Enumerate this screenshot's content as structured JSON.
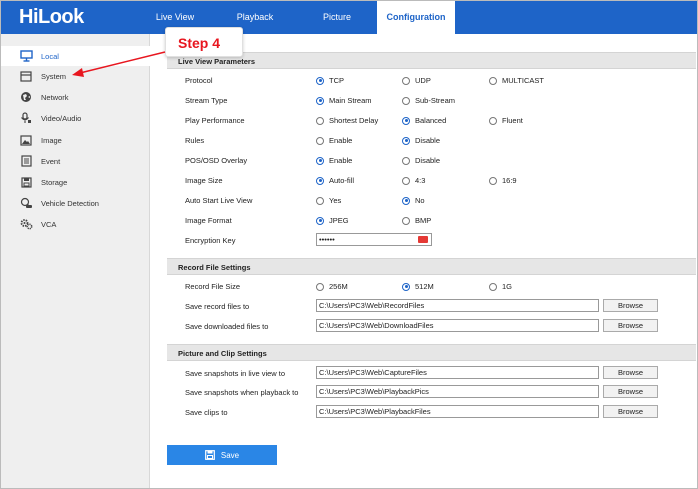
{
  "header": {
    "logo": "HiLook",
    "tabs": [
      "Live View",
      "Playback",
      "Picture",
      "Configuration"
    ],
    "active_tab": "Configuration",
    "accent_color": "#1e64c8"
  },
  "sidebar": {
    "items": [
      {
        "label": "Local",
        "icon": "monitor-icon"
      },
      {
        "label": "System",
        "icon": "window-icon"
      },
      {
        "label": "Network",
        "icon": "globe-icon"
      },
      {
        "label": "Video/Audio",
        "icon": "microphone-icon"
      },
      {
        "label": "Image",
        "icon": "picture-icon"
      },
      {
        "label": "Event",
        "icon": "event-list-icon"
      },
      {
        "label": "Storage",
        "icon": "floppy-disk-icon"
      },
      {
        "label": "Vehicle Detection",
        "icon": "car-search-icon"
      },
      {
        "label": "VCA",
        "icon": "gears-icon"
      }
    ],
    "active_item": "Local"
  },
  "annotation": {
    "step_label": "Step 4",
    "color": "#e8161f"
  },
  "live_view_section": {
    "title": "Live View Parameters",
    "rows": [
      {
        "label": "Protocol",
        "options": [
          "TCP",
          "UDP",
          "MULTICAST"
        ],
        "selected": "TCP"
      },
      {
        "label": "Stream Type",
        "options": [
          "Main Stream",
          "Sub-Stream"
        ],
        "selected": "Main Stream"
      },
      {
        "label": "Play Performance",
        "options": [
          "Shortest Delay",
          "Balanced",
          "Fluent"
        ],
        "selected": "Balanced"
      },
      {
        "label": "Rules",
        "options": [
          "Enable",
          "Disable"
        ],
        "selected": "Disable"
      },
      {
        "label": "POS/OSD Overlay",
        "options": [
          "Enable",
          "Disable"
        ],
        "selected": "Enable"
      },
      {
        "label": "Image Size",
        "options": [
          "Auto-fill",
          "4:3",
          "16:9"
        ],
        "selected": "Auto-fill"
      },
      {
        "label": "Auto Start Live View",
        "options": [
          "Yes",
          "No"
        ],
        "selected": "No"
      },
      {
        "label": "Image Format",
        "options": [
          "JPEG",
          "BMP"
        ],
        "selected": "JPEG"
      }
    ],
    "encryption_key": {
      "label": "Encryption Key",
      "value": "••••••"
    }
  },
  "record_section": {
    "title": "Record File Settings",
    "size_row": {
      "label": "Record File Size",
      "options": [
        "256M",
        "512M",
        "1G"
      ],
      "selected": "512M"
    },
    "paths": [
      {
        "label": "Save record files to",
        "value": "C:\\Users\\PC3\\Web\\RecordFiles"
      },
      {
        "label": "Save downloaded files to",
        "value": "C:\\Users\\PC3\\Web\\DownloadFiles"
      }
    ]
  },
  "picture_section": {
    "title": "Picture and Clip Settings",
    "paths": [
      {
        "label": "Save snapshots in live view to",
        "value": "C:\\Users\\PC3\\Web\\CaptureFiles"
      },
      {
        "label": "Save snapshots when playback to",
        "value": "C:\\Users\\PC3\\Web\\PlaybackPics"
      },
      {
        "label": "Save clips to",
        "value": "C:\\Users\\PC3\\Web\\PlaybackFiles"
      }
    ]
  },
  "browse_label": "Browse",
  "save_label": "Save"
}
